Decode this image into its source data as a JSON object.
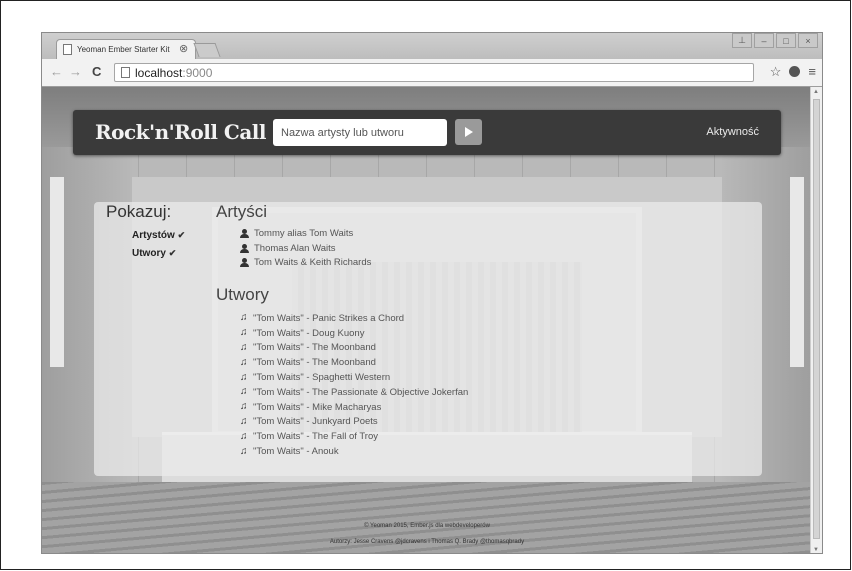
{
  "browser": {
    "tab_title": "Yeoman Ember Starter Kit",
    "tab_close": "⊗",
    "url_host": "localhost",
    "url_port": ":9000",
    "window_buttons": [
      "⊥",
      "–",
      "□",
      "×"
    ],
    "nav_back": "←",
    "nav_forward": "→",
    "nav_reload": "C",
    "star": "☆",
    "menu": "≡"
  },
  "navbar": {
    "brand": "Rock'n'Roll Call",
    "search_placeholder": "Nazwa artysty lub utworu",
    "activity_link": "Aktywność"
  },
  "filters": {
    "title": "Pokazuj:",
    "items": [
      {
        "label": "Artystów",
        "checked": "✔"
      },
      {
        "label": "Utwory",
        "checked": "✔"
      }
    ]
  },
  "artists": {
    "title": "Artyści",
    "items": [
      "Tommy alias Tom Waits",
      "Thomas Alan Waits",
      "Tom Waits & Keith Richards"
    ]
  },
  "songs": {
    "title": "Utwory",
    "items": [
      "\"Tom Waits\" - Panic Strikes a Chord",
      "\"Tom Waits\" - Doug Kuony",
      "\"Tom Waits\" - The Moonband",
      "\"Tom Waits\" - The Moonband",
      "\"Tom Waits\" - Spaghetti Western",
      "\"Tom Waits\" - The Passionate & Objective Jokerfan",
      "\"Tom Waits\" - Mike Macharyas",
      "\"Tom Waits\" - Junkyard Poets",
      "\"Tom Waits\" - The Fall of Troy",
      "\"Tom Waits\" - Anouk"
    ]
  },
  "footer": {
    "line1": "© Yeoman 2015, Ember.js dla webdeveloperów",
    "line2": "Autorzy: Jesse Cravens @jdcravens i Thomas Q. Brady @thomasqbrady"
  }
}
